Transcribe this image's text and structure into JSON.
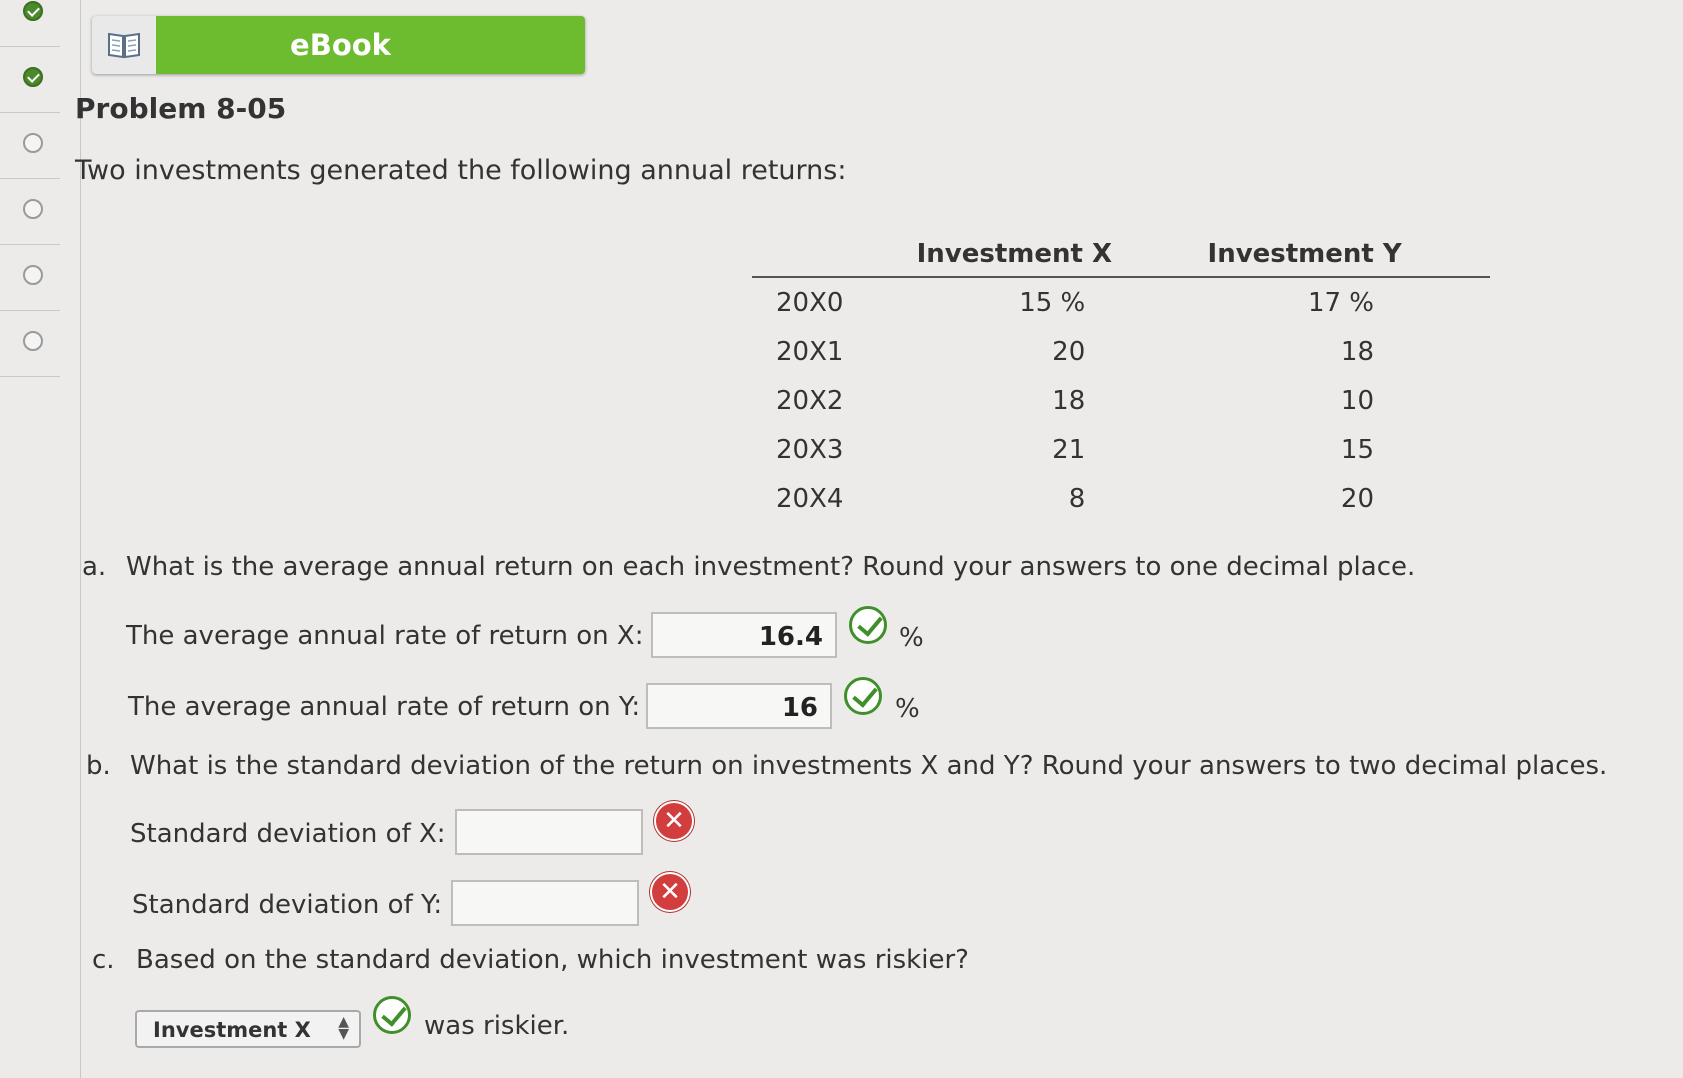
{
  "ebook": {
    "label": "eBook"
  },
  "problem": {
    "title": "Problem 8-05",
    "intro": "Two investments generated the following annual returns:"
  },
  "table": {
    "headers": [
      "",
      "Investment X",
      "Investment Y"
    ],
    "rows": [
      [
        "20X0",
        "15 %",
        "17 %"
      ],
      [
        "20X1",
        "20",
        "18"
      ],
      [
        "20X2",
        "18",
        "10"
      ],
      [
        "20X3",
        "21",
        "15"
      ],
      [
        "20X4",
        "8",
        "20"
      ]
    ]
  },
  "part_a": {
    "letter": "a.",
    "question": "What is the average annual return on each investment? Round your answers to one decimal place.",
    "x_label": "The average annual rate of return on X:",
    "x_value": "16.4",
    "y_label": "The average annual rate of return on Y:",
    "y_value": "16",
    "unit": "%"
  },
  "part_b": {
    "letter": "b.",
    "question": "What is the standard deviation of the return on investments X and Y? Round your answers to two decimal places.",
    "x_label": "Standard deviation of X:",
    "x_value": "",
    "y_label": "Standard deviation of Y:",
    "y_value": ""
  },
  "part_c": {
    "letter": "c.",
    "question": "Based on the standard deviation, which investment was riskier?",
    "selected": "Investment X",
    "suffix": "was riskier."
  },
  "icons": {
    "correct": "check-circle-icon",
    "incorrect": "x-circle-icon",
    "ebook": "book-icon"
  },
  "colors": {
    "ebook_green": "#6dbb2e",
    "correct_green": "#3f8f2a",
    "incorrect_red": "#d23d3d"
  }
}
